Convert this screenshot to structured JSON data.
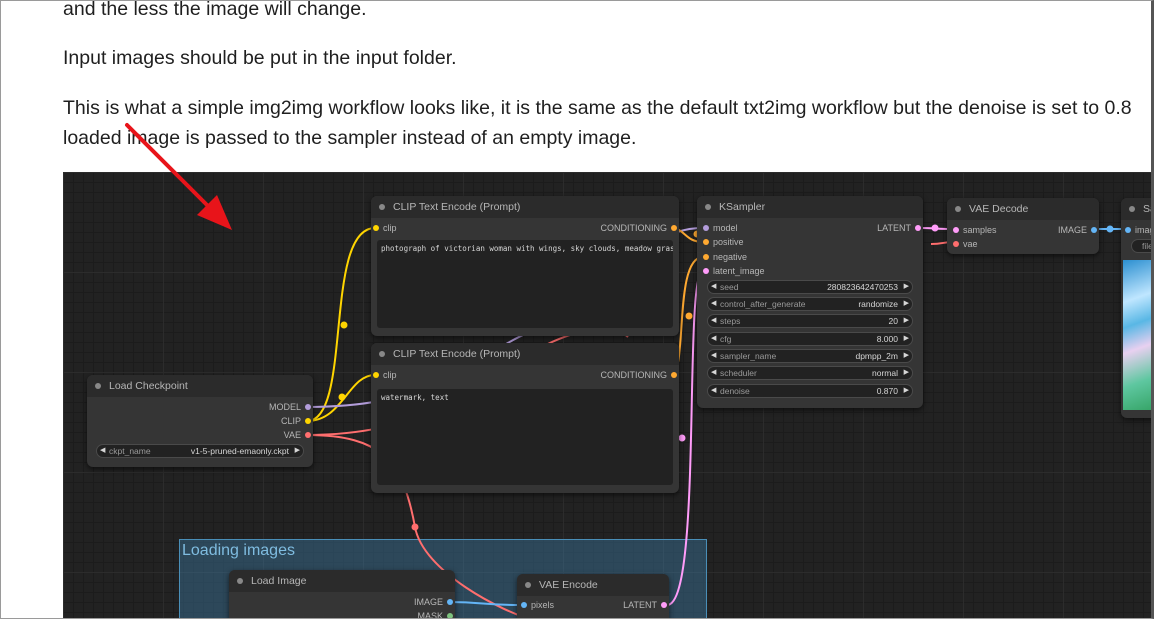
{
  "article": {
    "line_top": "and the less the image will change.",
    "line_input": "Input images should be put in the input folder.",
    "line_workflow_1": "This is what a simple img2img workflow looks like, it is the same as the default txt2img workflow but the denoise is set to 0.8",
    "line_workflow_2": "loaded image is passed to the sampler instead of an empty image."
  },
  "workflow": {
    "group_title": "Loading images",
    "load_checkpoint": {
      "title": "Load Checkpoint",
      "outputs": [
        "MODEL",
        "CLIP",
        "VAE"
      ],
      "ckpt_label": "ckpt_name",
      "ckpt_value": "v1-5-pruned-emaonly.ckpt"
    },
    "clip_pos": {
      "title": "CLIP Text Encode (Prompt)",
      "input": "clip",
      "output": "CONDITIONING",
      "text": "photograph of victorian woman with wings, sky clouds, meadow grass"
    },
    "clip_neg": {
      "title": "CLIP Text Encode (Prompt)",
      "input": "clip",
      "output": "CONDITIONING",
      "text": "watermark, text"
    },
    "ksampler": {
      "title": "KSampler",
      "inputs": [
        "model",
        "positive",
        "negative",
        "latent_image"
      ],
      "output": "LATENT",
      "widgets": [
        {
          "label": "seed",
          "value": "280823642470253"
        },
        {
          "label": "control_after_generate",
          "value": "randomize"
        },
        {
          "label": "steps",
          "value": "20"
        },
        {
          "label": "cfg",
          "value": "8.000"
        },
        {
          "label": "sampler_name",
          "value": "dpmpp_2m"
        },
        {
          "label": "scheduler",
          "value": "normal"
        },
        {
          "label": "denoise",
          "value": "0.870"
        }
      ]
    },
    "vae_decode": {
      "title": "VAE Decode",
      "inputs": [
        "samples",
        "vae"
      ],
      "output": "IMAGE"
    },
    "save_image": {
      "title": "Sa",
      "input": "imag",
      "widget": "file"
    },
    "load_image": {
      "title": "Load Image",
      "outputs": [
        "IMAGE",
        "MASK"
      ]
    },
    "vae_encode": {
      "title": "VAE Encode",
      "input": "pixels",
      "output": "LATENT"
    }
  },
  "colors": {
    "model": "#b39ddb",
    "clip": "#ffd500",
    "vae": "#ff6e6e",
    "conditioning": "#ffa931",
    "latent": "#ff9cf9",
    "image": "#64b5f6",
    "arrow": "#e8141a"
  }
}
